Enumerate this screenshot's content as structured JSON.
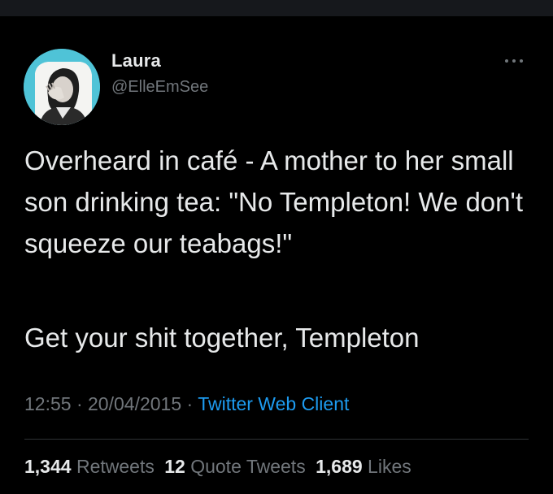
{
  "tweet": {
    "author": {
      "name": "Laura",
      "handle": "@ElleEmSee",
      "avatar_icon": "profile-photo-avatar"
    },
    "paragraphs": [
      "Overheard in café - A mother to her small son drinking tea: \"No Templeton! We don't squeeze our teabags!\"",
      "Get your shit together, Templeton"
    ],
    "time": "12:55",
    "date": "20/04/2015",
    "separator": "·",
    "client": "Twitter Web Client",
    "stats": {
      "retweets": {
        "count": "1,344",
        "label": "Retweets"
      },
      "quotes": {
        "count": "12",
        "label": "Quote Tweets"
      },
      "likes": {
        "count": "1,689",
        "label": "Likes"
      }
    },
    "more_icon": "more-horizontal-icon"
  },
  "colors": {
    "background": "#000000",
    "primary_text": "#E7E9EA",
    "secondary_text": "#71767B",
    "link": "#1D9BF0",
    "avatar_bg": "#4FC3D7",
    "divider": "#2F3336"
  }
}
